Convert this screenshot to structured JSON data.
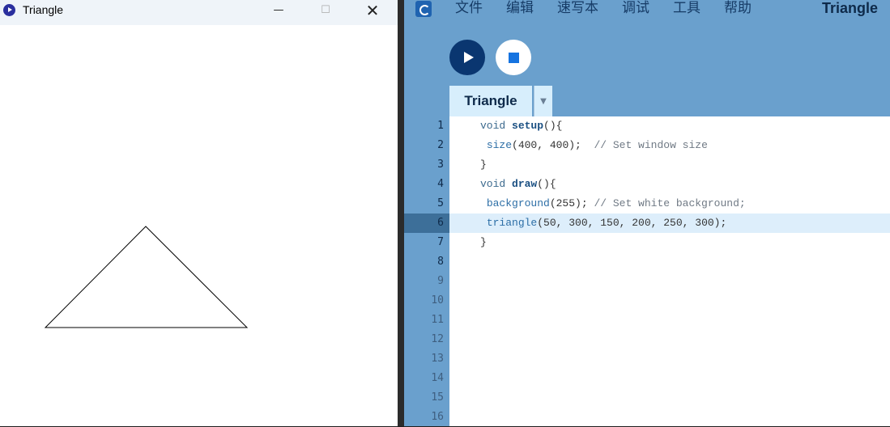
{
  "sketch_window": {
    "title": "Triangle",
    "controls": {
      "minimize": "—",
      "maximize": "☐",
      "close": "✕"
    }
  },
  "ide": {
    "menu": [
      "文件",
      "编辑",
      "速写本",
      "调试",
      "工具",
      "帮助"
    ],
    "title": "Triangle",
    "tab": {
      "label": "Triangle",
      "dropdown": "▼"
    },
    "line_numbers": [
      "1",
      "2",
      "3",
      "4",
      "5",
      "6",
      "7",
      "8",
      "9",
      "10",
      "11",
      "12",
      "13",
      "14",
      "15",
      "16"
    ],
    "active_line": 6,
    "code": [
      [
        {
          "t": "void ",
          "c": "kw"
        },
        {
          "t": "setup",
          "c": "fn-def"
        },
        {
          "t": "(){",
          "c": ""
        }
      ],
      [
        {
          "t": " ",
          "c": ""
        },
        {
          "t": "size",
          "c": "fn"
        },
        {
          "t": "(400, 400);  ",
          "c": ""
        },
        {
          "t": "// Set window size",
          "c": "cmt"
        }
      ],
      [
        {
          "t": "}",
          "c": ""
        }
      ],
      [
        {
          "t": "void ",
          "c": "kw"
        },
        {
          "t": "draw",
          "c": "fn-def"
        },
        {
          "t": "(){",
          "c": ""
        }
      ],
      [
        {
          "t": " ",
          "c": ""
        },
        {
          "t": "background",
          "c": "fn"
        },
        {
          "t": "(255); ",
          "c": ""
        },
        {
          "t": "// Set white background;",
          "c": "cmt"
        }
      ],
      [
        {
          "t": " ",
          "c": ""
        },
        {
          "t": "triangle",
          "c": "fn"
        },
        {
          "t": "(50, 300, 150, 200, 250, 300);",
          "c": ""
        }
      ],
      [
        {
          "t": "}",
          "c": ""
        }
      ],
      [],
      [],
      [],
      [],
      [],
      [],
      [],
      [],
      []
    ]
  },
  "colors": {
    "ide_background": "#6aa0cd",
    "run_button": "#0a3670",
    "stop_icon": "#1573e0",
    "active_line_gutter": "#3d6f99",
    "active_line_editor": "#ddeefb"
  },
  "icons": [
    "sketch-app-icon",
    "ide-logo-icon",
    "play-icon",
    "stop-icon",
    "dropdown-arrow-icon"
  ]
}
